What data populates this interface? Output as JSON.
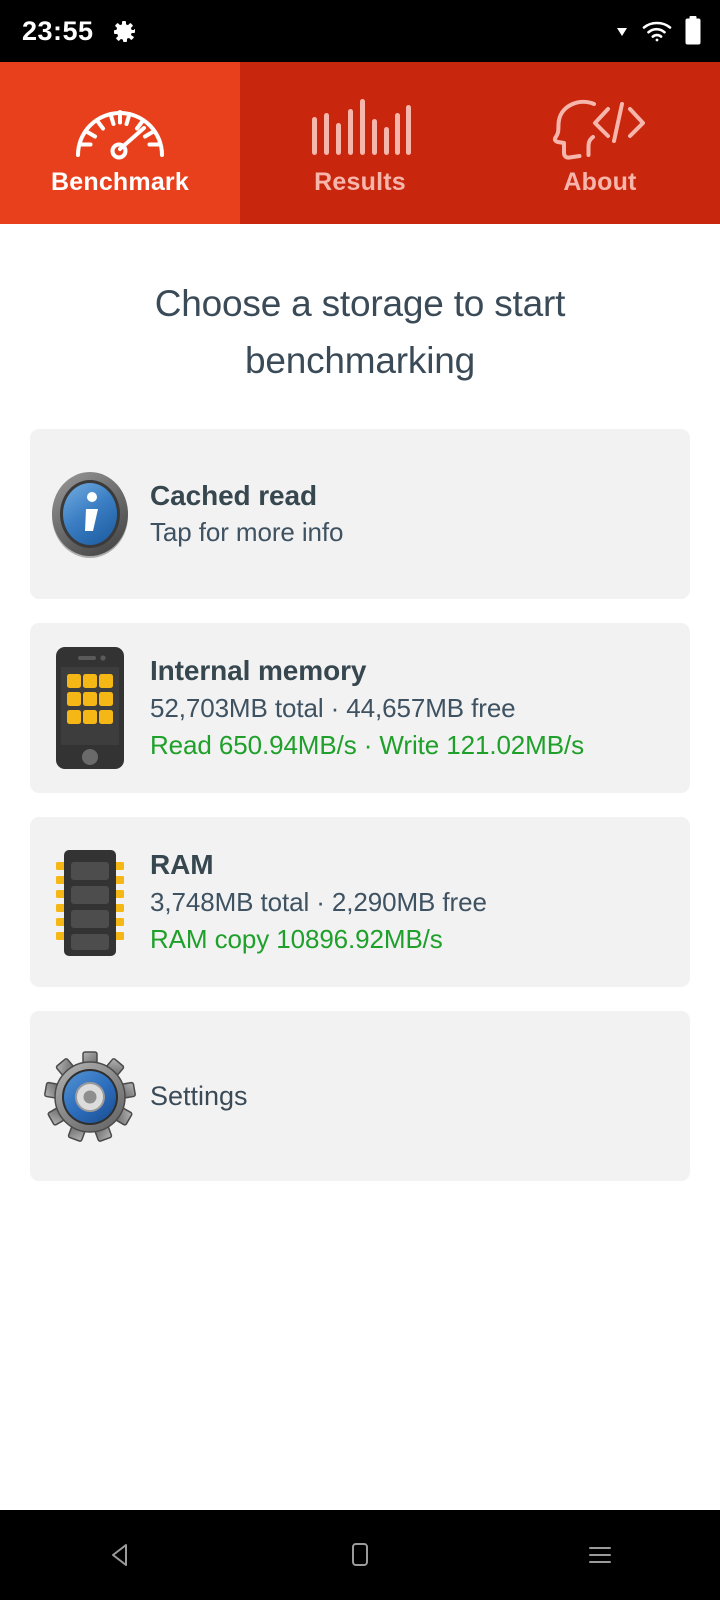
{
  "statusbar": {
    "time": "23:55",
    "icons": [
      "gear-icon",
      "dropdown-triangle-icon",
      "wifi-icon",
      "battery-icon"
    ]
  },
  "tabs": [
    {
      "label": "Benchmark",
      "icon": "speedometer-icon",
      "active": true
    },
    {
      "label": "Results",
      "icon": "bar-chart-icon",
      "active": false
    },
    {
      "label": "About",
      "icon": "head-code-icon",
      "active": false
    }
  ],
  "main": {
    "headline": "Choose a storage to start benchmarking",
    "cards": [
      {
        "id": "cached-read",
        "icon": "info-icon",
        "title": "Cached read",
        "subtitle": "Tap for more info",
        "speed": ""
      },
      {
        "id": "internal-memory",
        "icon": "phone-icon",
        "title": "Internal memory",
        "subtitle": "52,703MB total · 44,657MB free",
        "speed": "Read 650.94MB/s · Write 121.02MB/s"
      },
      {
        "id": "ram",
        "icon": "memory-chip-icon",
        "title": "RAM",
        "subtitle": "3,748MB total · 2,290MB free",
        "speed": "RAM copy 10896.92MB/s"
      }
    ],
    "settings": {
      "id": "settings",
      "icon": "gear-settings-icon",
      "label": "Settings"
    }
  },
  "navbar": {
    "back": "back-icon",
    "home": "home-icon",
    "recents": "recents-icon"
  },
  "colors": {
    "tab_active_bg": "#E8401D",
    "tab_inactive_bg": "#C9260E",
    "tab_inactive_text": "#F7B6AB",
    "card_bg": "#F2F2F2",
    "title_text": "#37474F",
    "speed_text": "#1FA02B",
    "status_bar_bg": "#000000"
  }
}
